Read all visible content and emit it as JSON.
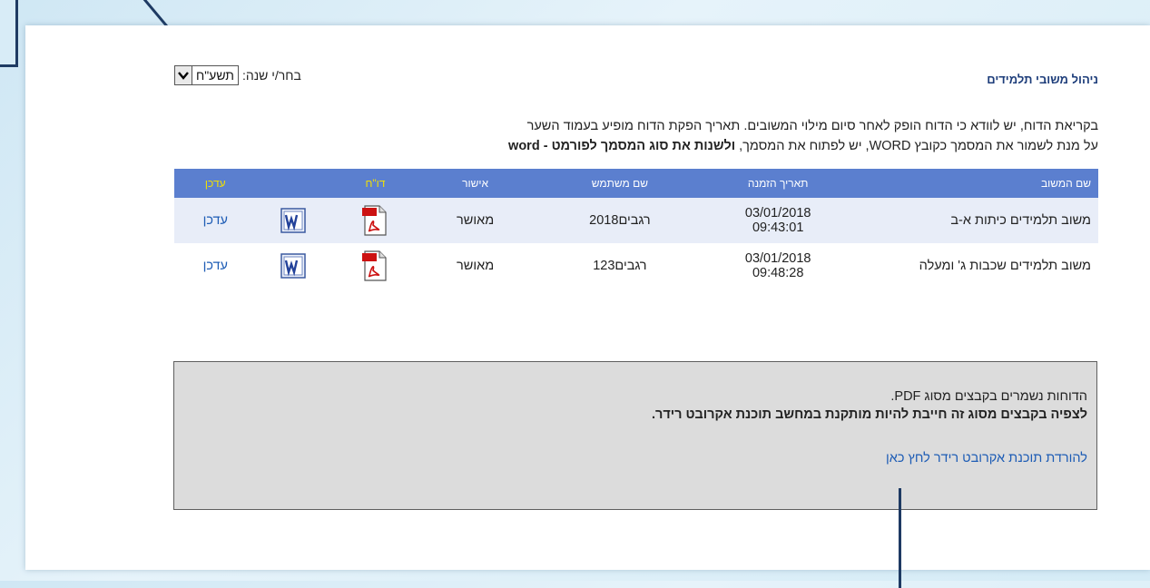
{
  "header": {
    "title": "ניהול משובי תלמידים",
    "year_label": "בחר/י שנה:",
    "year_value": "תשע\"ח"
  },
  "intro": {
    "line1": "בקריאת הדוח, יש לוודא כי הדוח הופק לאחר סיום מילוי המשובים. תאריך הפקת הדוח מופיע בעמוד השער",
    "line2_normal": "על מנת לשמור את המסמך כקובץ WORD, יש לפתוח את המסמך, ",
    "line2_bold": "ולשנות את סוג המסמך לפורמט - word"
  },
  "table": {
    "headers": [
      "שם המשוב",
      "תאריך הזמנה",
      "שם משתמש",
      "אישור",
      "דו\"ח",
      "",
      "עדכן"
    ],
    "rows": [
      {
        "name": "משוב תלמידים כיתות א-ב",
        "date": "03/01/2018",
        "time": "09:43:01",
        "user": "רגבים2018",
        "status": "מאושר",
        "update": "עדכן"
      },
      {
        "name": "משוב תלמידים שכבות ג' ומעלה",
        "date": "03/01/2018",
        "time": "09:48:28",
        "user": "רגבים123",
        "status": "מאושר",
        "update": "עדכן"
      }
    ]
  },
  "info": {
    "line1": "הדוחות נשמרים בקבצים מסוג PDF.",
    "line2": "לצפיה בקבצים מסוג זה חייבת להיות מותקנת במחשב תוכנת אקרובט רידר.",
    "download_link": "להורדת תוכנת אקרובט רידר לחץ כאן"
  },
  "icons": {
    "pdf": "pdf-file-icon",
    "word": "word-file-icon",
    "dropdown": "chevron-down-icon"
  },
  "colors": {
    "header_bg": "#5b7fcf",
    "title": "#1d3d7a",
    "link": "#1d5cb5",
    "update_header": "#f2e100"
  }
}
